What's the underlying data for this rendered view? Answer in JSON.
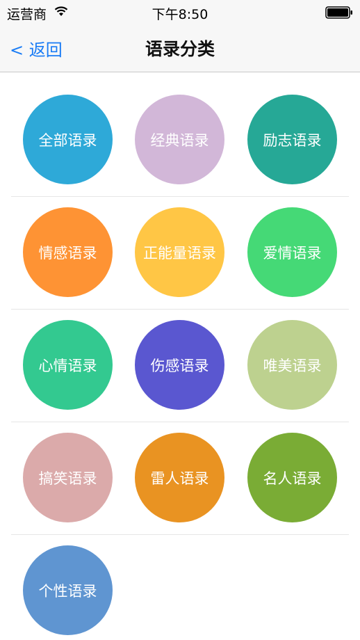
{
  "status_bar": {
    "carrier": "运营商",
    "time": "下午8:50"
  },
  "nav": {
    "back_label": "< 返回",
    "title": "语录分类"
  },
  "categories": [
    {
      "label": "全部语录",
      "color": "#2ea9d8"
    },
    {
      "label": "经典语录",
      "color": "#d2b7d8"
    },
    {
      "label": "励志语录",
      "color": "#26a896"
    },
    {
      "label": "情感语录",
      "color": "#fe9334"
    },
    {
      "label": "正能量语录",
      "color": "#ffc645"
    },
    {
      "label": "爱情语录",
      "color": "#45d976"
    },
    {
      "label": "心情语录",
      "color": "#33c990"
    },
    {
      "label": "伤感语录",
      "color": "#5a57d0"
    },
    {
      "label": "唯美语录",
      "color": "#bdd18f"
    },
    {
      "label": "搞笑语录",
      "color": "#dbaaaa"
    },
    {
      "label": "雷人语录",
      "color": "#e99322"
    },
    {
      "label": "名人语录",
      "color": "#7aac35"
    },
    {
      "label": "个性语录",
      "color": "#5f95d1"
    }
  ]
}
